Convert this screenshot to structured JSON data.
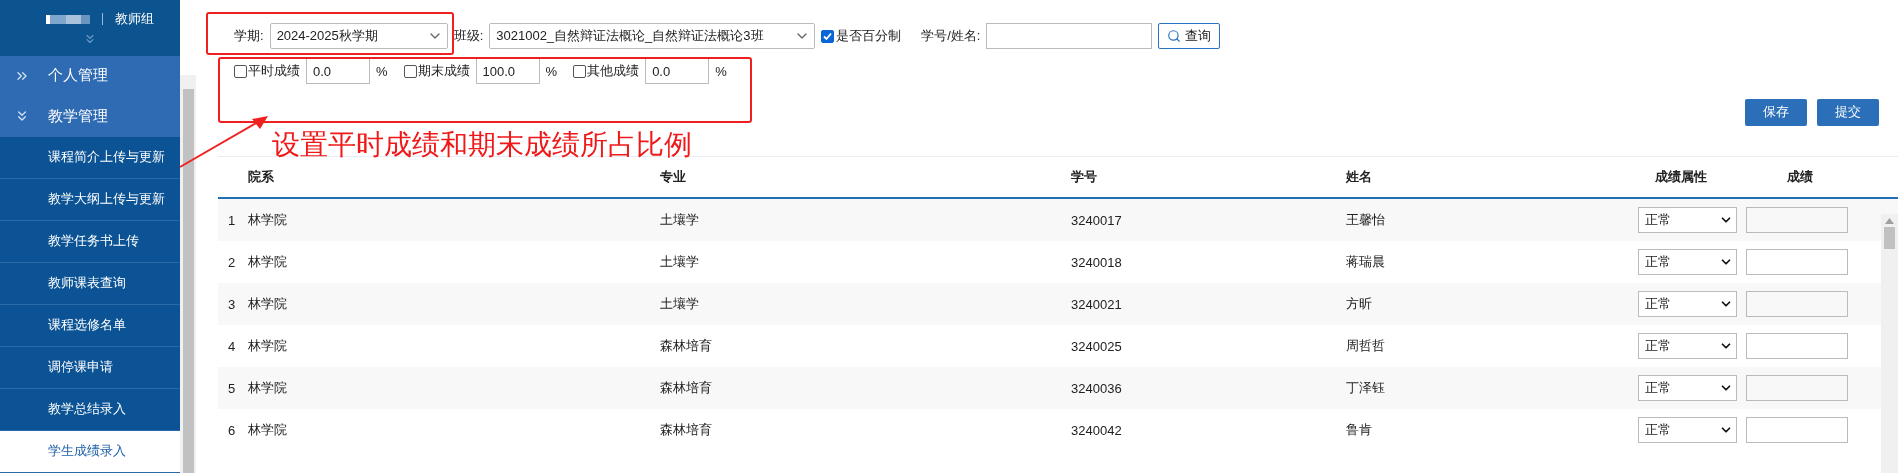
{
  "sidebar": {
    "group": "教师组",
    "menus": [
      {
        "label": "个人管理",
        "expanded": false
      },
      {
        "label": "教学管理",
        "expanded": true,
        "children": [
          {
            "label": "课程简介上传与更新",
            "selected": false
          },
          {
            "label": "教学大纲上传与更新",
            "selected": false
          },
          {
            "label": "教学任务书上传",
            "selected": false
          },
          {
            "label": "教师课表查询",
            "selected": false
          },
          {
            "label": "课程选修名单",
            "selected": false
          },
          {
            "label": "调停课申请",
            "selected": false
          },
          {
            "label": "教学总结录入",
            "selected": false
          },
          {
            "label": "学生成绩录入",
            "selected": true
          }
        ]
      }
    ]
  },
  "filters": {
    "term": {
      "label": "学期:",
      "value": "2024-2025秋学期"
    },
    "class": {
      "label": "班级:",
      "value": "3021002_自然辩证法概论_自然辩证法概论3班"
    },
    "percent": {
      "label": "是否百分制",
      "checked": true
    },
    "search": {
      "label": "学号/姓名:"
    },
    "query_button": "查询"
  },
  "weights": [
    {
      "label": "平时成绩",
      "checked": false,
      "value": "0.0",
      "unit": "%"
    },
    {
      "label": "期末成绩",
      "checked": false,
      "value": "100.0",
      "unit": "%"
    },
    {
      "label": "其他成绩",
      "checked": false,
      "value": "0.0",
      "unit": "%"
    }
  ],
  "buttons": [
    "保存",
    "提交"
  ],
  "annotation": "设置平时成绩和期末成绩所占比例",
  "table": {
    "columns": [
      "院系",
      "专业",
      "学号",
      "姓名",
      "成绩属性",
      "成绩"
    ],
    "rows": [
      {
        "index": "1",
        "dept": "林学院",
        "major": "土壤学",
        "id": "3240017",
        "name": "王馨怡",
        "attribute": "正常"
      },
      {
        "index": "2",
        "dept": "林学院",
        "major": "土壤学",
        "id": "3240018",
        "name": "蒋瑞晨",
        "attribute": "正常"
      },
      {
        "index": "3",
        "dept": "林学院",
        "major": "土壤学",
        "id": "3240021",
        "name": "方昕",
        "attribute": "正常"
      },
      {
        "index": "4",
        "dept": "林学院",
        "major": "森林培育",
        "id": "3240025",
        "name": "周哲哲",
        "attribute": "正常"
      },
      {
        "index": "5",
        "dept": "林学院",
        "major": "森林培育",
        "id": "3240036",
        "name": "丁泽钰",
        "attribute": "正常"
      },
      {
        "index": "6",
        "dept": "林学院",
        "major": "森林培育",
        "id": "3240042",
        "name": "鲁肯",
        "attribute": "正常"
      }
    ]
  }
}
